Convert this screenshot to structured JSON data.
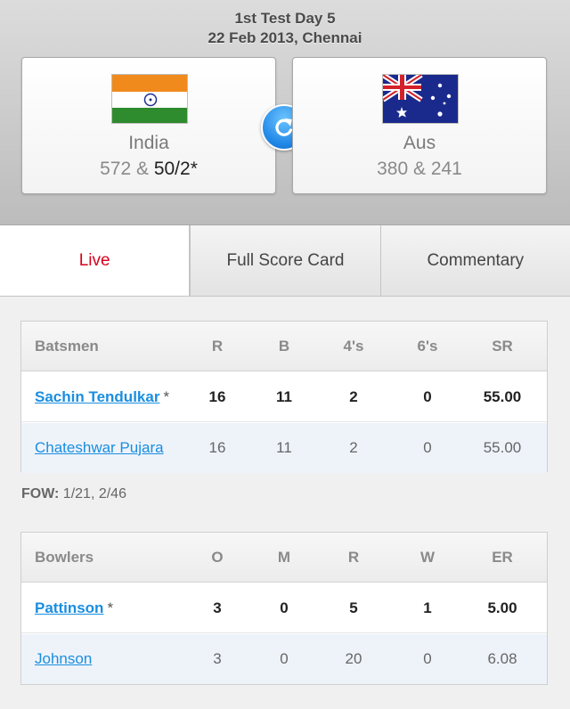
{
  "header": {
    "match_title": "1st Test Day 5",
    "match_date": "22 Feb 2013, Chennai"
  },
  "teams": {
    "home": {
      "name": "India",
      "score_prev": "572 & ",
      "score_current": "50/2*",
      "flag": "india-flag-icon"
    },
    "away": {
      "name": "Aus",
      "score": "380 & 241",
      "flag": "australia-flag-icon"
    }
  },
  "tabs": [
    {
      "label": "Live",
      "active": true
    },
    {
      "label": "Full Score Card",
      "active": false
    },
    {
      "label": "Commentary",
      "active": false
    }
  ],
  "batting": {
    "headers": [
      "Batsmen",
      "R",
      "B",
      "4's",
      "6's",
      "SR"
    ],
    "rows": [
      {
        "name": "Sachin Tendulkar",
        "star": "*",
        "R": "16",
        "B": "11",
        "4s": "2",
        "6s": "0",
        "SR": "55.00"
      },
      {
        "name": "Chateshwar Pujara",
        "star": "",
        "R": "16",
        "B": "11",
        "4s": "2",
        "6s": "0",
        "SR": "55.00"
      }
    ]
  },
  "fow": {
    "label": "FOW:",
    "value": " 1/21, 2/46"
  },
  "bowling": {
    "headers": [
      "Bowlers",
      "O",
      "M",
      "R",
      "W",
      "ER"
    ],
    "rows": [
      {
        "name": "Pattinson",
        "star": "*",
        "O": "3",
        "M": "0",
        "R": "5",
        "W": "1",
        "ER": "5.00"
      },
      {
        "name": "Johnson",
        "star": "",
        "O": "3",
        "M": "0",
        "R": "20",
        "W": "0",
        "ER": "6.08"
      }
    ]
  },
  "colors": {
    "active_tab": "#d9001b",
    "link": "#1a8ee0",
    "refresh": "#1f86e6"
  },
  "icons": {
    "refresh": "refresh-icon"
  }
}
